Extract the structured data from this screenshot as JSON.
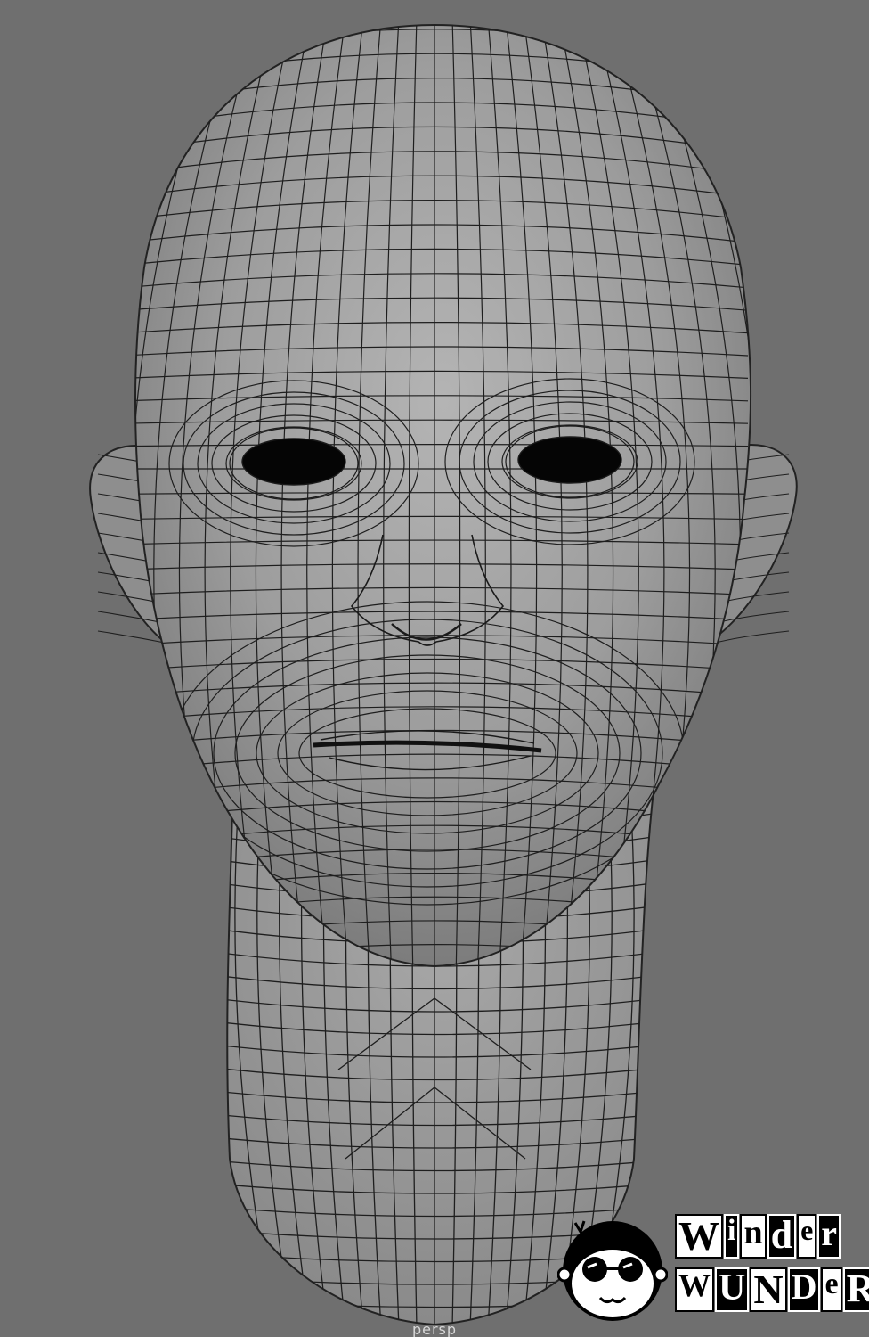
{
  "viewport": {
    "camera_label": "persp",
    "background_color": "#6f6f6f",
    "mesh_surface_color": "#9a9a9a",
    "wire_color": "#1a1a1a"
  },
  "watermark": {
    "line1": [
      "W",
      "i",
      "n",
      "d",
      "e",
      "r"
    ],
    "line2": [
      "W",
      "U",
      "N",
      "D",
      "e",
      "R"
    ],
    "mascot": "cartoon-face-with-glasses-icon"
  }
}
